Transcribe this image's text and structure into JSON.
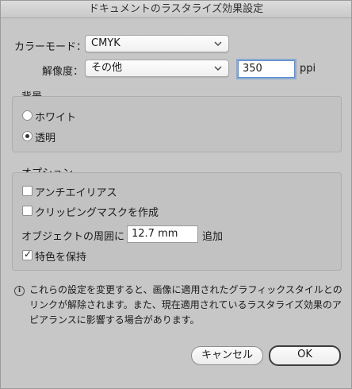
{
  "window": {
    "title": "ドキュメントのラスタライズ効果設定"
  },
  "color_mode": {
    "label": "カラーモード：",
    "value": "CMYK"
  },
  "resolution": {
    "label": "解像度：",
    "value": "その他",
    "input_value": "350",
    "unit": "ppi"
  },
  "background": {
    "title": "背景",
    "options": [
      {
        "label": "ホワイト",
        "selected": false
      },
      {
        "label": "透明",
        "selected": true
      }
    ]
  },
  "options": {
    "title": "オプション",
    "antialias": {
      "label": "アンチエイリアス",
      "checked": false
    },
    "clipping_mask": {
      "label": "クリッピングマスクを作成",
      "checked": false
    },
    "padding": {
      "label": "オブジェクトの周囲に",
      "value": "12.7 mm",
      "suffix": "追加"
    },
    "preserve_spot": {
      "label": "特色を保持",
      "checked": true
    }
  },
  "info": {
    "line1": "これらの設定を変更すると、画像に適用されたグラフィックスタイルとの",
    "line2": "リンクが解除されます。また、現在適用されているラスタライズ効果のア",
    "line3": "ピアランスに影響する場合があります。"
  },
  "buttons": {
    "cancel": "キャンセル",
    "ok": "OK"
  }
}
